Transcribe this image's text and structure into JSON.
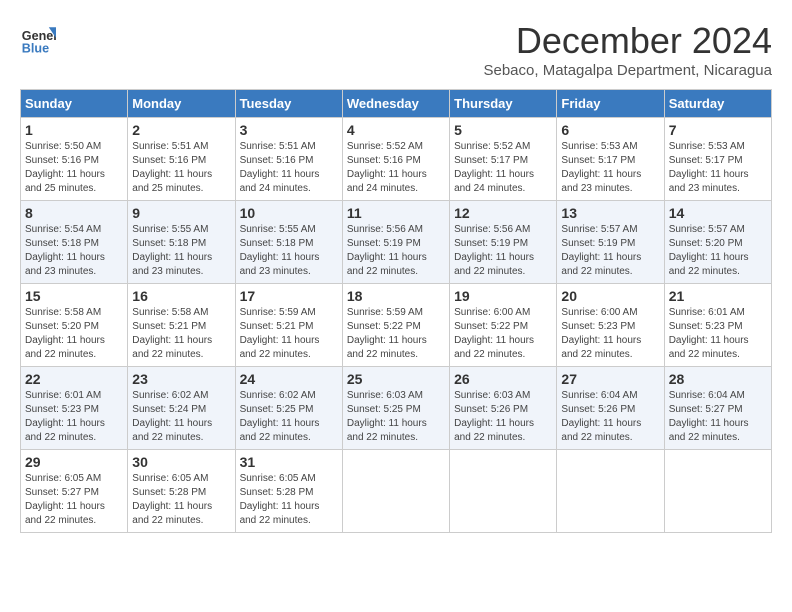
{
  "logo": {
    "line1": "General",
    "line2": "Blue"
  },
  "title": "December 2024",
  "location": "Sebaco, Matagalpa Department, Nicaragua",
  "weekdays": [
    "Sunday",
    "Monday",
    "Tuesday",
    "Wednesday",
    "Thursday",
    "Friday",
    "Saturday"
  ],
  "weeks": [
    [
      {
        "day": "1",
        "sunrise": "5:50 AM",
        "sunset": "5:16 PM",
        "daylight": "11 hours and 25 minutes."
      },
      {
        "day": "2",
        "sunrise": "5:51 AM",
        "sunset": "5:16 PM",
        "daylight": "11 hours and 25 minutes."
      },
      {
        "day": "3",
        "sunrise": "5:51 AM",
        "sunset": "5:16 PM",
        "daylight": "11 hours and 24 minutes."
      },
      {
        "day": "4",
        "sunrise": "5:52 AM",
        "sunset": "5:16 PM",
        "daylight": "11 hours and 24 minutes."
      },
      {
        "day": "5",
        "sunrise": "5:52 AM",
        "sunset": "5:17 PM",
        "daylight": "11 hours and 24 minutes."
      },
      {
        "day": "6",
        "sunrise": "5:53 AM",
        "sunset": "5:17 PM",
        "daylight": "11 hours and 23 minutes."
      },
      {
        "day": "7",
        "sunrise": "5:53 AM",
        "sunset": "5:17 PM",
        "daylight": "11 hours and 23 minutes."
      }
    ],
    [
      {
        "day": "8",
        "sunrise": "5:54 AM",
        "sunset": "5:18 PM",
        "daylight": "11 hours and 23 minutes."
      },
      {
        "day": "9",
        "sunrise": "5:55 AM",
        "sunset": "5:18 PM",
        "daylight": "11 hours and 23 minutes."
      },
      {
        "day": "10",
        "sunrise": "5:55 AM",
        "sunset": "5:18 PM",
        "daylight": "11 hours and 23 minutes."
      },
      {
        "day": "11",
        "sunrise": "5:56 AM",
        "sunset": "5:19 PM",
        "daylight": "11 hours and 22 minutes."
      },
      {
        "day": "12",
        "sunrise": "5:56 AM",
        "sunset": "5:19 PM",
        "daylight": "11 hours and 22 minutes."
      },
      {
        "day": "13",
        "sunrise": "5:57 AM",
        "sunset": "5:19 PM",
        "daylight": "11 hours and 22 minutes."
      },
      {
        "day": "14",
        "sunrise": "5:57 AM",
        "sunset": "5:20 PM",
        "daylight": "11 hours and 22 minutes."
      }
    ],
    [
      {
        "day": "15",
        "sunrise": "5:58 AM",
        "sunset": "5:20 PM",
        "daylight": "11 hours and 22 minutes."
      },
      {
        "day": "16",
        "sunrise": "5:58 AM",
        "sunset": "5:21 PM",
        "daylight": "11 hours and 22 minutes."
      },
      {
        "day": "17",
        "sunrise": "5:59 AM",
        "sunset": "5:21 PM",
        "daylight": "11 hours and 22 minutes."
      },
      {
        "day": "18",
        "sunrise": "5:59 AM",
        "sunset": "5:22 PM",
        "daylight": "11 hours and 22 minutes."
      },
      {
        "day": "19",
        "sunrise": "6:00 AM",
        "sunset": "5:22 PM",
        "daylight": "11 hours and 22 minutes."
      },
      {
        "day": "20",
        "sunrise": "6:00 AM",
        "sunset": "5:23 PM",
        "daylight": "11 hours and 22 minutes."
      },
      {
        "day": "21",
        "sunrise": "6:01 AM",
        "sunset": "5:23 PM",
        "daylight": "11 hours and 22 minutes."
      }
    ],
    [
      {
        "day": "22",
        "sunrise": "6:01 AM",
        "sunset": "5:23 PM",
        "daylight": "11 hours and 22 minutes."
      },
      {
        "day": "23",
        "sunrise": "6:02 AM",
        "sunset": "5:24 PM",
        "daylight": "11 hours and 22 minutes."
      },
      {
        "day": "24",
        "sunrise": "6:02 AM",
        "sunset": "5:25 PM",
        "daylight": "11 hours and 22 minutes."
      },
      {
        "day": "25",
        "sunrise": "6:03 AM",
        "sunset": "5:25 PM",
        "daylight": "11 hours and 22 minutes."
      },
      {
        "day": "26",
        "sunrise": "6:03 AM",
        "sunset": "5:26 PM",
        "daylight": "11 hours and 22 minutes."
      },
      {
        "day": "27",
        "sunrise": "6:04 AM",
        "sunset": "5:26 PM",
        "daylight": "11 hours and 22 minutes."
      },
      {
        "day": "28",
        "sunrise": "6:04 AM",
        "sunset": "5:27 PM",
        "daylight": "11 hours and 22 minutes."
      }
    ],
    [
      {
        "day": "29",
        "sunrise": "6:05 AM",
        "sunset": "5:27 PM",
        "daylight": "11 hours and 22 minutes."
      },
      {
        "day": "30",
        "sunrise": "6:05 AM",
        "sunset": "5:28 PM",
        "daylight": "11 hours and 22 minutes."
      },
      {
        "day": "31",
        "sunrise": "6:05 AM",
        "sunset": "5:28 PM",
        "daylight": "11 hours and 22 minutes."
      },
      null,
      null,
      null,
      null
    ]
  ]
}
